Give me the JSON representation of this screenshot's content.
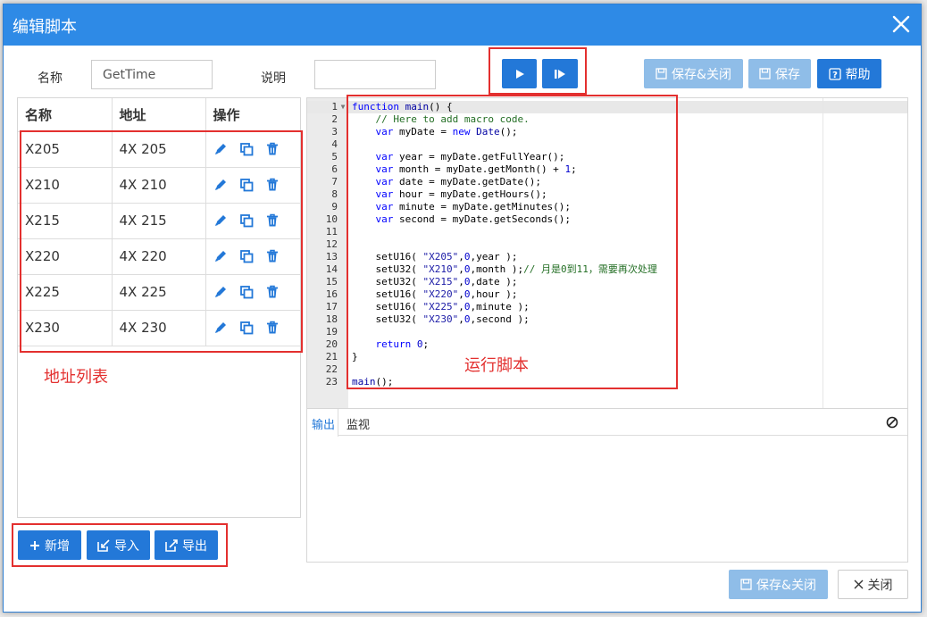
{
  "dialog": {
    "title": "编辑脚本",
    "close_icon": "close-icon"
  },
  "form": {
    "name_label": "名称",
    "name_value": "GetTime",
    "desc_label": "说明",
    "desc_value": ""
  },
  "toolbar": {
    "run_icon": "play-icon",
    "step_icon": "step-icon",
    "save_close_label": "保存&关闭",
    "save_label": "保存",
    "help_label": "帮助"
  },
  "address_table": {
    "headers": [
      "名称",
      "地址",
      "操作"
    ],
    "rows": [
      {
        "name": "X205",
        "address": "4X 205"
      },
      {
        "name": "X210",
        "address": "4X 210"
      },
      {
        "name": "X215",
        "address": "4X 215"
      },
      {
        "name": "X220",
        "address": "4X 220"
      },
      {
        "name": "X225",
        "address": "4X 225"
      },
      {
        "name": "X230",
        "address": "4X 230"
      }
    ],
    "row_actions": [
      "edit-icon",
      "copy-icon",
      "delete-icon"
    ]
  },
  "annotations": {
    "address_list": "地址列表",
    "run_script": "运行脚本"
  },
  "left_buttons": {
    "add_label": "新增",
    "import_label": "导入",
    "export_label": "导出"
  },
  "code_lines": [
    "function main() {",
    "    // Here to add macro code.",
    "    var myDate = new Date();",
    "",
    "    var year = myDate.getFullYear();",
    "    var month = myDate.getMonth() + 1;",
    "    var date = myDate.getDate();",
    "    var hour = myDate.getHours();",
    "    var minute = myDate.getMinutes();",
    "    var second = myDate.getSeconds();",
    "",
    "",
    "    setU16( \"X205\",0,year );",
    "    setU32( \"X210\",0,month );// 月是0到11，需要再次处理",
    "    setU32( \"X215\",0,date );",
    "    setU16( \"X220\",0,hour );",
    "    setU16( \"X225\",0,minute );",
    "    setU32( \"X230\",0,second );",
    "",
    "    return 0;",
    "}",
    "",
    "main();"
  ],
  "output_panel": {
    "tab_output": "输出",
    "tab_watch": "监视",
    "clear_icon": "clear-icon"
  },
  "footer": {
    "save_close_label": "保存&关闭",
    "close_label": "关闭"
  },
  "colors": {
    "primary": "#2378d8",
    "titlebar": "#2e8ae6",
    "disabled": "#8fbde8",
    "annotation": "#e3302f"
  }
}
